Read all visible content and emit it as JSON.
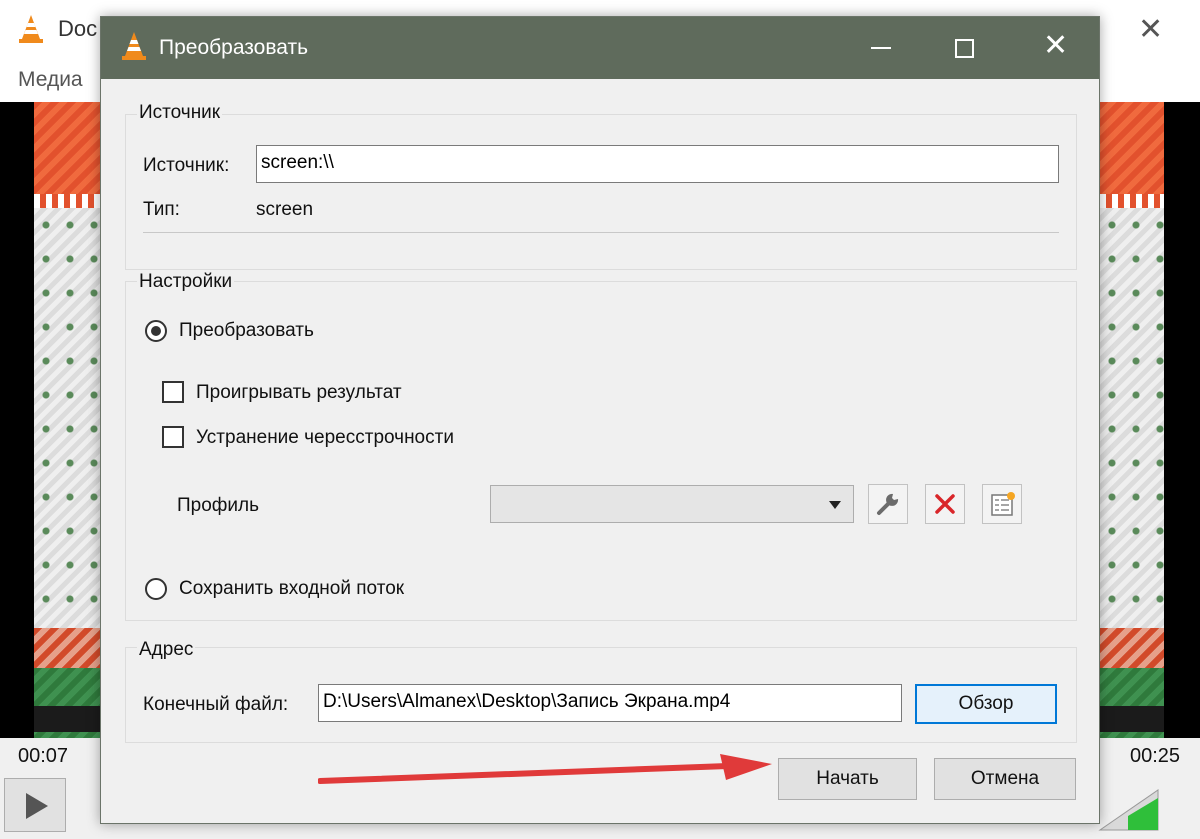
{
  "background_window": {
    "title": "Doc",
    "menu_media": "Медиа",
    "close_glyph": "✕",
    "time_elapsed": "00:07",
    "time_total": "00:25"
  },
  "dialog": {
    "title": "Преобразовать",
    "close_glyph": "✕",
    "source_group": {
      "title": "Источник",
      "source_label": "Источник:",
      "source_value": "screen:\\\\",
      "type_label": "Тип:",
      "type_value": "screen"
    },
    "settings_group": {
      "title": "Настройки",
      "convert_label": "Преобразовать",
      "convert_selected": true,
      "play_result_label": "Проигрывать результат",
      "play_result_checked": false,
      "deinterlace_label": "Устранение чересстрочности",
      "deinterlace_checked": false,
      "profile_label": "Профиль",
      "profile_value": "",
      "save_stream_label": "Сохранить входной поток",
      "save_stream_selected": false
    },
    "address_group": {
      "title": "Адрес",
      "dest_label": "Конечный файл:",
      "dest_value": "D:\\Users\\Almanex\\Desktop\\Запись Экрана.mp4",
      "browse_label": "Обзор"
    },
    "start_label": "Начать",
    "cancel_label": "Отмена"
  },
  "colors": {
    "dialog_titlebar": "#5f6b5c",
    "annotation_arrow": "#e03a3a",
    "default_button_border": "#0078d7",
    "delete_icon": "#d9262a"
  },
  "icons": [
    "vlc-cone-icon",
    "minimize-icon",
    "maximize-icon",
    "close-icon",
    "wrench-icon",
    "delete-x-icon",
    "new-profile-icon",
    "play-icon",
    "chevron-down-icon",
    "volume-icon"
  ]
}
